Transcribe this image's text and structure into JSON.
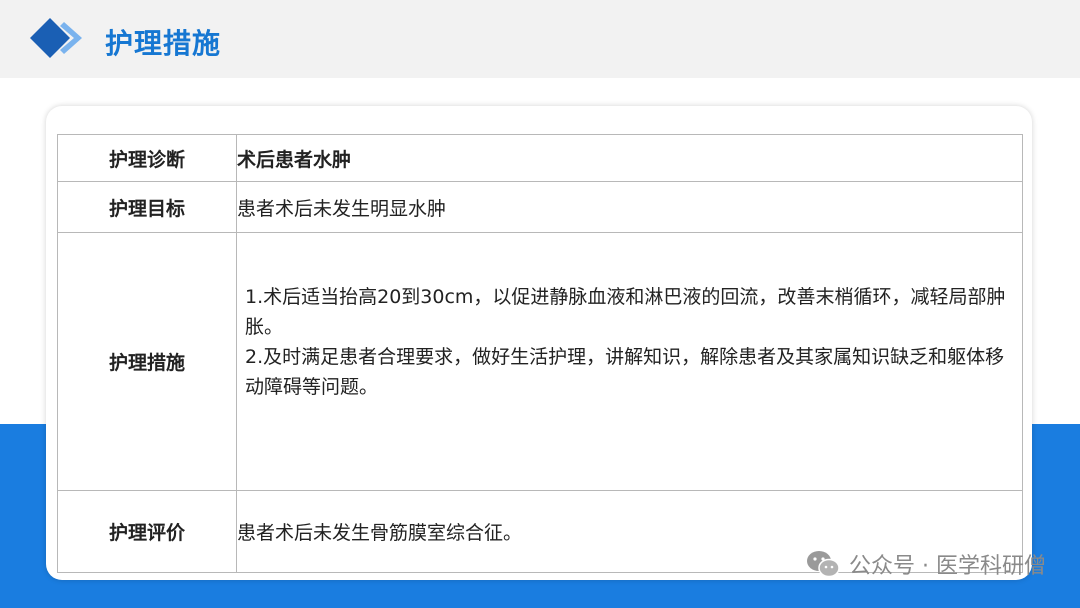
{
  "header": {
    "title": "护理措施"
  },
  "table": {
    "rows": [
      {
        "label": "护理诊断",
        "value": "术后患者水肿"
      },
      {
        "label": "护理目标",
        "value": "患者术后未发生明显水肿"
      },
      {
        "label": "护理措施",
        "items": [
          "1.术后适当抬高20到30cm，以促进静脉血液和淋巴液的回流，改善末梢循环，减轻局部肿胀。",
          "2.及时满足患者合理要求，做好生活护理，讲解知识，解除患者及其家属知识缺乏和躯体移动障碍等问题。"
        ]
      },
      {
        "label": "护理评价",
        "value": "患者术后未发生骨筋膜室综合征。"
      }
    ]
  },
  "watermark": {
    "text": "公众号 · 医学科研僧",
    "icon": "wechat-icon"
  },
  "colors": {
    "accent": "#1677d2",
    "band": "#1a7de0",
    "header_bg": "#f2f2f2"
  }
}
